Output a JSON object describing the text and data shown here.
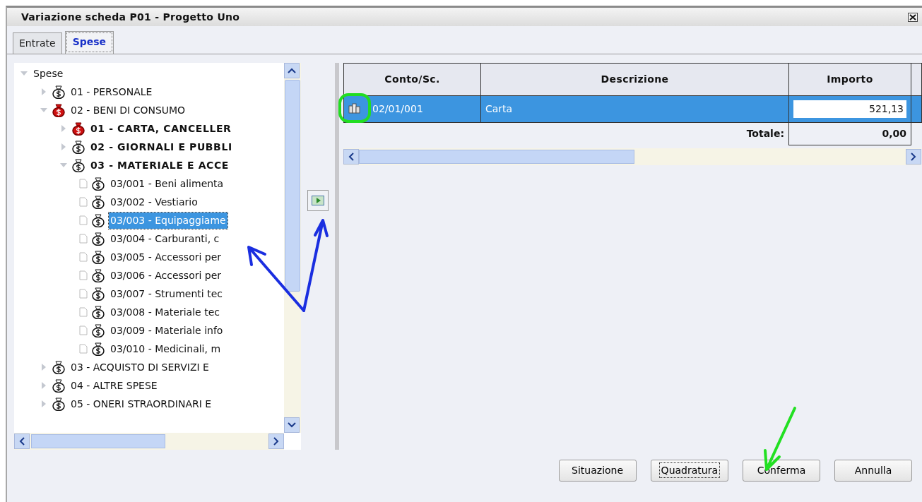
{
  "window": {
    "title": "Variazione scheda P01 - Progetto Uno"
  },
  "tabs": [
    {
      "label": "Entrate",
      "selected": false
    },
    {
      "label": "Spese",
      "selected": true
    }
  ],
  "tree": [
    {
      "label": "Spese",
      "kind": "root",
      "expanded": true,
      "selected": false,
      "children": [
        {
          "label": "01 - PERSONALE",
          "kind": "group",
          "expanded": false,
          "flagged": false,
          "selected": false
        },
        {
          "label": "02 - BENI DI CONSUMO",
          "kind": "group",
          "expanded": true,
          "flagged": true,
          "selected": false,
          "children": [
            {
              "label": "01 - CARTA, CANCELLER",
              "kind": "group",
              "expanded": false,
              "flagged": true,
              "selected": false
            },
            {
              "label": "02 - GIORNALI E PUBBLI",
              "kind": "group",
              "expanded": false,
              "flagged": false,
              "selected": false
            },
            {
              "label": "03 - MATERIALE E ACCE",
              "kind": "group",
              "expanded": true,
              "flagged": false,
              "selected": false,
              "children": [
                {
                  "label": "03/001 - Beni alimenta",
                  "kind": "leaf",
                  "flagged": false,
                  "selected": false
                },
                {
                  "label": "03/002 - Vestiario",
                  "kind": "leaf",
                  "flagged": false,
                  "selected": false
                },
                {
                  "label": "03/003 - Equipaggiame",
                  "kind": "leaf",
                  "flagged": false,
                  "selected": true
                },
                {
                  "label": "03/004 - Carburanti, c",
                  "kind": "leaf",
                  "flagged": false,
                  "selected": false
                },
                {
                  "label": "03/005 - Accessori per",
                  "kind": "leaf",
                  "flagged": false,
                  "selected": false
                },
                {
                  "label": "03/006 - Accessori per",
                  "kind": "leaf",
                  "flagged": false,
                  "selected": false
                },
                {
                  "label": "03/007 - Strumenti tec",
                  "kind": "leaf",
                  "flagged": false,
                  "selected": false
                },
                {
                  "label": "03/008 - Materiale tec",
                  "kind": "leaf",
                  "flagged": false,
                  "selected": false
                },
                {
                  "label": "03/009 - Materiale info",
                  "kind": "leaf",
                  "flagged": false,
                  "selected": false
                },
                {
                  "label": "03/010 - Medicinali, m",
                  "kind": "leaf",
                  "flagged": false,
                  "selected": false
                }
              ]
            }
          ]
        },
        {
          "label": "03 - ACQUISTO DI SERVIZI E",
          "kind": "group",
          "expanded": false,
          "flagged": false,
          "selected": false
        },
        {
          "label": "04 - ALTRE SPESE",
          "kind": "group",
          "expanded": false,
          "flagged": false,
          "selected": false
        },
        {
          "label": "05 - ONERI STRAORDINARI E",
          "kind": "group",
          "expanded": false,
          "flagged": false,
          "selected": false
        }
      ]
    }
  ],
  "grid": {
    "columns": [
      "Conto/Sc.",
      "Descrizione",
      "Importo"
    ],
    "rows": [
      {
        "code": "02/01/001",
        "description": "Carta",
        "amount": "521,13",
        "selected": true
      }
    ],
    "total_label": "Totale:",
    "total": "0,00"
  },
  "buttons": [
    {
      "label": "Situazione",
      "focused": false
    },
    {
      "label": "Quadratura",
      "focused": true
    },
    {
      "label": "Conferma",
      "focused": false
    },
    {
      "label": "Annulla",
      "focused": false
    }
  ]
}
